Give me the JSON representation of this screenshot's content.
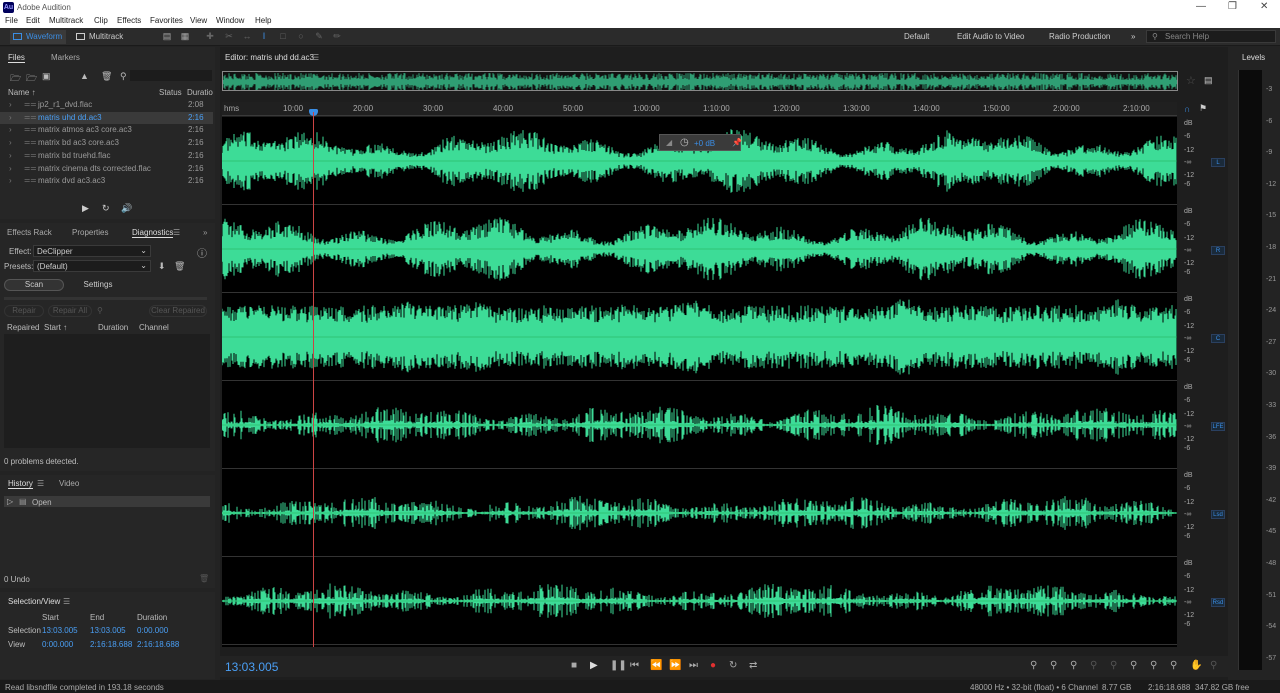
{
  "app": {
    "title": "Adobe Audition",
    "logo": "Au"
  },
  "menu": [
    "File",
    "Edit",
    "Multitrack",
    "Clip",
    "Effects",
    "Favorites",
    "View",
    "Window",
    "Help"
  ],
  "toolbar": {
    "waveform": "Waveform",
    "multitrack": "Multitrack",
    "workspaces": [
      "Default",
      "Edit Audio to Video",
      "Radio Production"
    ],
    "search_placeholder": "Search Help"
  },
  "files_panel": {
    "tabs": [
      "Files",
      "Markers"
    ],
    "columns": {
      "name": "Name ↑",
      "status": "Status",
      "duration": "Duratio"
    },
    "items": [
      {
        "name": "jp2_r1_dvd.flac",
        "duration": "2:08"
      },
      {
        "name": "matris uhd dd.ac3",
        "duration": "2:16",
        "selected": true
      },
      {
        "name": "matrix atmos ac3 core.ac3",
        "duration": "2:16"
      },
      {
        "name": "matrix bd ac3 core.ac3",
        "duration": "2:16"
      },
      {
        "name": "matrix bd truehd.flac",
        "duration": "2:16"
      },
      {
        "name": "matrix cinema dts corrected.flac",
        "duration": "2:16"
      },
      {
        "name": "matrix dvd ac3.ac3",
        "duration": "2:16"
      }
    ]
  },
  "diagnostics_panel": {
    "tabs": [
      "Effects Rack",
      "Properties",
      "Diagnostics"
    ],
    "effect_label": "Effect:",
    "effect_value": "DeClipper",
    "presets_label": "Presets:",
    "presets_value": "(Default)",
    "scan": "Scan",
    "settings": "Settings",
    "repair": "Repair",
    "repair_all": "Repair All",
    "clear_repaired": "Clear Repaired",
    "columns": [
      "Repaired",
      "Start ↑",
      "Duration",
      "Channel"
    ],
    "status": "0 problems detected."
  },
  "history_panel": {
    "tabs": [
      "History",
      "Video"
    ],
    "items": [
      "Open"
    ],
    "undo": "0 Undo"
  },
  "selection_view": {
    "title": "Selection/View",
    "columns": [
      "Start",
      "End",
      "Duration"
    ],
    "rows": [
      {
        "label": "Selection",
        "start": "13:03.005",
        "end": "13:03.005",
        "duration": "0:00.000"
      },
      {
        "label": "View",
        "start": "0:00.000",
        "end": "2:16:18.688",
        "duration": "2:16:18.688"
      }
    ]
  },
  "editor": {
    "title": "Editor: matris uhd dd.ac3",
    "ruler_unit": "hms",
    "ruler_ticks": [
      "10:00",
      "20:00",
      "30:00",
      "40:00",
      "50:00",
      "1:00:00",
      "1:10:00",
      "1:20:00",
      "1:30:00",
      "1:40:00",
      "1:50:00",
      "2:00:00",
      "2:10:00"
    ],
    "hud_value": "+0 dB",
    "db_labels": [
      "dB",
      "-6",
      "-12",
      "-∞",
      "-12",
      "-6"
    ],
    "channels": [
      "L",
      "R",
      "C",
      "LFE",
      "Lsd",
      "Rsd"
    ],
    "waveform_color": "#3ddc97",
    "timecode": "13:03.005"
  },
  "levels": {
    "title": "Levels",
    "ticks": [
      "-3",
      "-6",
      "-9",
      "-12",
      "-15",
      "-18",
      "-21",
      "-24",
      "-27",
      "-30",
      "-33",
      "-36",
      "-39",
      "-42",
      "-45",
      "-48",
      "-51",
      "-54",
      "-57"
    ]
  },
  "status_bar": {
    "message": "Read libsndfile completed in 193.18 seconds",
    "format": "48000 Hz • 32-bit (float) • 6 Channel",
    "size": "8.77 GB",
    "duration": "2:16:18.688",
    "free": "347.82 GB free"
  }
}
